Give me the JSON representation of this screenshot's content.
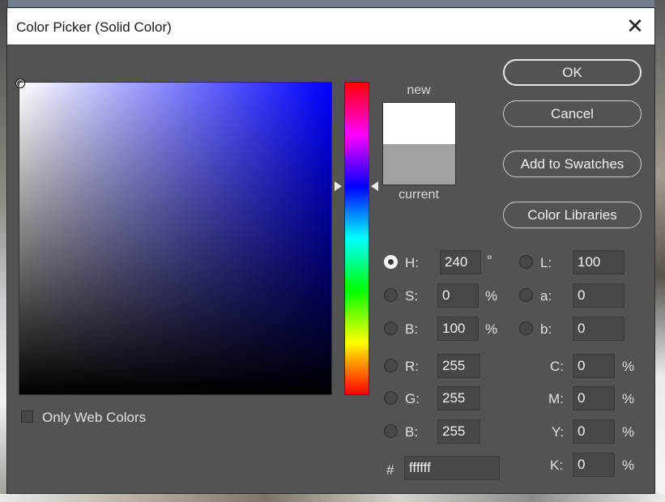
{
  "window": {
    "title": "Color Picker (Solid Color)",
    "close_glyph": "✕"
  },
  "swatch": {
    "new_label": "new",
    "current_label": "current",
    "new_color": "#ffffff",
    "current_color": "#a0a0a0"
  },
  "buttons": {
    "ok": "OK",
    "cancel": "Cancel",
    "add_to_swatches": "Add to Swatches",
    "color_libraries": "Color Libraries"
  },
  "hsb": {
    "h_label": "H:",
    "h_value": "240",
    "h_unit": "°",
    "s_label": "S:",
    "s_value": "0",
    "s_unit": "%",
    "b_label": "B:",
    "b_value": "100",
    "b_unit": "%"
  },
  "rgb": {
    "r_label": "R:",
    "r_value": "255",
    "g_label": "G:",
    "g_value": "255",
    "b_label": "B:",
    "b_value": "255"
  },
  "lab": {
    "l_label": "L:",
    "l_value": "100",
    "a_label": "a:",
    "a_value": "0",
    "b_label": "b:",
    "b_value": "0"
  },
  "cmyk": {
    "c_label": "C:",
    "c_value": "0",
    "m_label": "M:",
    "m_value": "0",
    "y_label": "Y:",
    "y_value": "0",
    "k_label": "K:",
    "k_value": "0",
    "unit": "%"
  },
  "hex": {
    "label": "#",
    "value": "ffffff"
  },
  "options": {
    "only_web_colors": "Only Web Colors"
  },
  "colors": {
    "dialog_bg": "#535353",
    "field_hue": "#0000ff"
  }
}
